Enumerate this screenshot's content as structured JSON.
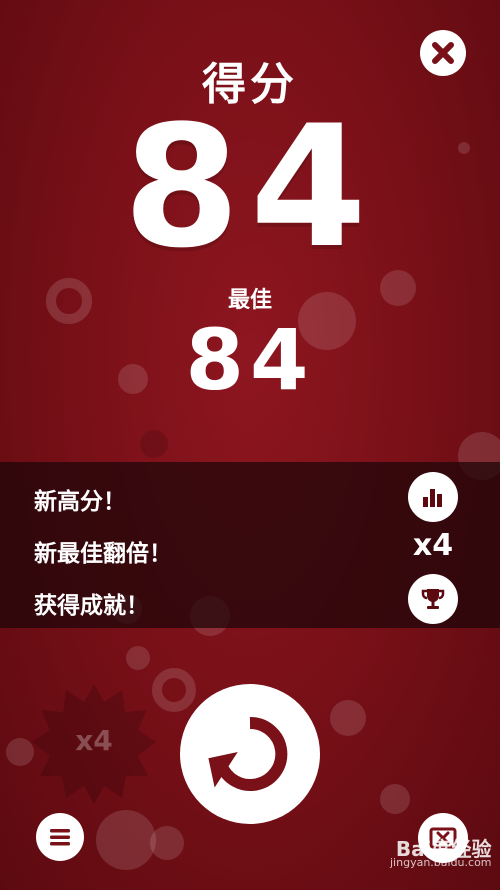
{
  "score": {
    "label": "得分",
    "value": "84"
  },
  "best": {
    "label": "最佳",
    "value": "84"
  },
  "results": [
    {
      "text": "新高分！",
      "icon": "leaderboard-icon"
    },
    {
      "text": "新最佳翻倍！",
      "badge": "x4"
    },
    {
      "text": "获得成就！",
      "icon": "trophy-icon"
    }
  ],
  "powerup_badge": {
    "label": "x4"
  },
  "buttons": {
    "close": "close-icon",
    "restart": "restart-icon",
    "menu": "menu-icon",
    "video": "video-icon"
  },
  "watermark": {
    "brand": "Bai度经验",
    "url": "jingyan.baidu.com"
  },
  "colors": {
    "background": "#7a1018",
    "panel": "#1c0608",
    "accent": "#8e1620",
    "foreground": "#ffffff"
  }
}
